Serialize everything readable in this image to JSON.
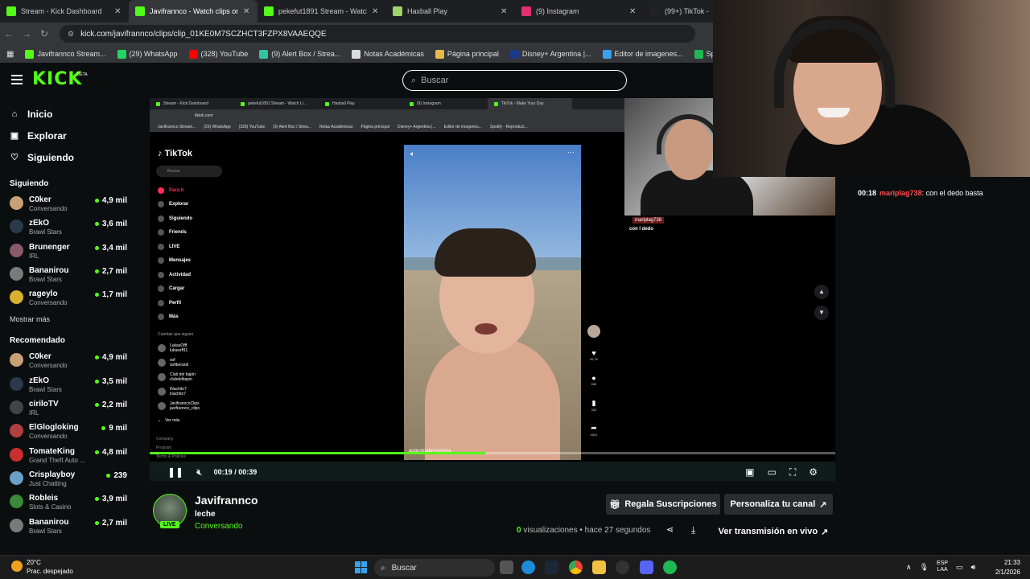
{
  "browser": {
    "tabs": [
      {
        "title": "Stream - Kick Dashboard",
        "color": "#53fc18",
        "active": false
      },
      {
        "title": "Javifrannco - Watch clips on Kick",
        "color": "#53fc18",
        "active": true
      },
      {
        "title": "pekefut1891 Stream - Watch Live",
        "color": "#53fc18",
        "active": false
      },
      {
        "title": "Haxball Play",
        "color": "#9fd36b",
        "active": false
      },
      {
        "title": "(9) Instagram",
        "color": "#e1306c",
        "active": false
      },
      {
        "title": "(99+) TikTok -",
        "color": "#222222",
        "active": false
      }
    ],
    "url": "kick.com/javifrannco/clips/clip_01KE0M7SCZHCT3FZPX8VAAEQQE",
    "bookmarks": [
      {
        "label": "Javifrannco Stream...",
        "color": "#53fc18"
      },
      {
        "label": "(29) WhatsApp",
        "color": "#25d366"
      },
      {
        "label": "(328) YouTube",
        "color": "#ff0000"
      },
      {
        "label": "(9) Alert Box / Strea...",
        "color": "#31c3a2"
      },
      {
        "label": "Notas Académicas",
        "color": "#dddddd"
      },
      {
        "label": "Página principal",
        "color": "#e8b84a"
      },
      {
        "label": "Disney+ Argentina |...",
        "color": "#1b3a8a"
      },
      {
        "label": "Editor de imagenes...",
        "color": "#3aa0f0"
      },
      {
        "label": "Spotify - Reproduct...",
        "color": "#1db954"
      }
    ]
  },
  "kick": {
    "logo": "KICK",
    "beta": "BETA",
    "search_placeholder": "Buscar"
  },
  "sidebar": {
    "nav": [
      {
        "label": "Inicio",
        "icon": "home-icon",
        "glyph": "⌂"
      },
      {
        "label": "Explorar",
        "icon": "compass-icon",
        "glyph": "▣"
      },
      {
        "label": "Siguiendo",
        "icon": "heart-icon",
        "glyph": "♡"
      }
    ],
    "following_title": "Siguiendo",
    "following": [
      {
        "name": "C0ker",
        "category": "Conversando",
        "viewers": "4,9 mil",
        "avatar": "#c8a078"
      },
      {
        "name": "zEkO",
        "category": "Brawl Stars",
        "viewers": "3,6 mil",
        "avatar": "#2a3a4a"
      },
      {
        "name": "Brunenger",
        "category": "IRL",
        "viewers": "3,4 mil",
        "avatar": "#8a5a6a"
      },
      {
        "name": "Bananirou",
        "category": "Brawl Stars",
        "viewers": "2,7 mil",
        "avatar": "#7a7a7a"
      },
      {
        "name": "rageylo",
        "category": "Conversando",
        "viewers": "1,7 mil",
        "avatar": "#d8b030"
      }
    ],
    "show_more": "Mostrar más",
    "recommended_title": "Recomendado",
    "recommended": [
      {
        "name": "C0ker",
        "category": "Conversando",
        "viewers": "4,9 mil",
        "avatar": "#c8a078"
      },
      {
        "name": "zEkO",
        "category": "Brawl Stars",
        "viewers": "3,5 mil",
        "avatar": "#2a3a4a"
      },
      {
        "name": "ciriloTV",
        "category": "IRL",
        "viewers": "2,2 mil",
        "avatar": "#444444"
      },
      {
        "name": "ElGlogloking",
        "category": "Conversando",
        "viewers": "9 mil",
        "avatar": "#b04040"
      },
      {
        "name": "TomateKing",
        "category": "Grand Theft Auto ...",
        "viewers": "4,8 mil",
        "avatar": "#c83030"
      },
      {
        "name": "Crisplayboy",
        "category": "Just Chatting",
        "viewers": "239",
        "avatar": "#6aa0c8"
      },
      {
        "name": "Robleis",
        "category": "Slots & Casino",
        "viewers": "3,9 mil",
        "avatar": "#3a8a3a"
      },
      {
        "name": "Bananirou",
        "category": "Brawl Stars",
        "viewers": "2,7 mil",
        "avatar": "#7a7a7a"
      }
    ]
  },
  "video": {
    "inner_tabs": [
      "Stream - Kick Dashboard",
      "pekefut1891 Stream - Watch Li...",
      "Haxball Play",
      "(9) Instagram",
      "TikTok - Make Your Day"
    ],
    "inner_url": "tiktok.com",
    "inner_bookmarks": [
      "Javifrannco Stream...",
      "(29) WhatsApp",
      "(328) YouTube",
      "(9) Alert Box / Strea...",
      "Notas Académicas",
      "Página principal",
      "Disney+ Argentina |...",
      "Editor de imagenes...",
      "Spotify - Reproduct..."
    ],
    "tiktok": {
      "logo": "TikTok",
      "search": "Buscar",
      "nav": [
        "Para ti",
        "Explorar",
        "Siguiendo",
        "Friends",
        "LIVE",
        "Mensajes",
        "Actividad",
        "Cargar",
        "Perfil",
        "Más"
      ],
      "following_head": "Cuentas que sigues",
      "following": [
        {
          "name": "LukasOfff",
          "handle": "lukasoff11"
        },
        {
          "name": "sof",
          "handle": "sofiberardi"
        },
        {
          "name": "Club del bajón",
          "handle": "clubdelbajon"
        },
        {
          "name": "iNachito7",
          "handle": "inachito7"
        },
        {
          "name": "JavifranncoClips",
          "handle": "javifrannco_clips"
        }
      ],
      "see_more": "Ver más",
      "footer": [
        "Company",
        "Program",
        "Terms & Policies",
        "© 2026 TikTok"
      ],
      "caption": "augustoalonsoyotra",
      "actions": [
        {
          "glyph": "♥",
          "count": "20,7K",
          "name": "like-icon"
        },
        {
          "glyph": "●",
          "count": "656",
          "name": "comment-icon"
        },
        {
          "glyph": "▮",
          "count": "332",
          "name": "bookmark-icon"
        },
        {
          "glyph": "➦",
          "count": "9501",
          "name": "share-icon"
        }
      ]
    },
    "overlay_chat_user": "mariplag738",
    "overlay_chat_text": "con l dedo",
    "time_current": "00:19",
    "time_total": "00:39",
    "progress": 0.49
  },
  "chat": {
    "lines": [
      {
        "time": "00:18",
        "user": "mariplag738",
        "text": "con el dedo basta"
      }
    ]
  },
  "clip_info": {
    "channel": "Javifrannco",
    "title": "leche",
    "category": "Conversando",
    "live": "LIVE",
    "gift_btn": "Regala Suscripciones",
    "custom_btn": "Personaliza tu canal",
    "views_count": "0",
    "views_label": "visualizaciones",
    "ago": "• hace 27 segundos",
    "live_btn": "Ver transmisión en vivo"
  },
  "taskbar": {
    "temp": "20°C",
    "weather": "Prac. despejado",
    "search": "Buscar",
    "lang_top": "ESP",
    "lang_bottom": "LAA",
    "time": "21:33",
    "date": "2/1/2026"
  }
}
